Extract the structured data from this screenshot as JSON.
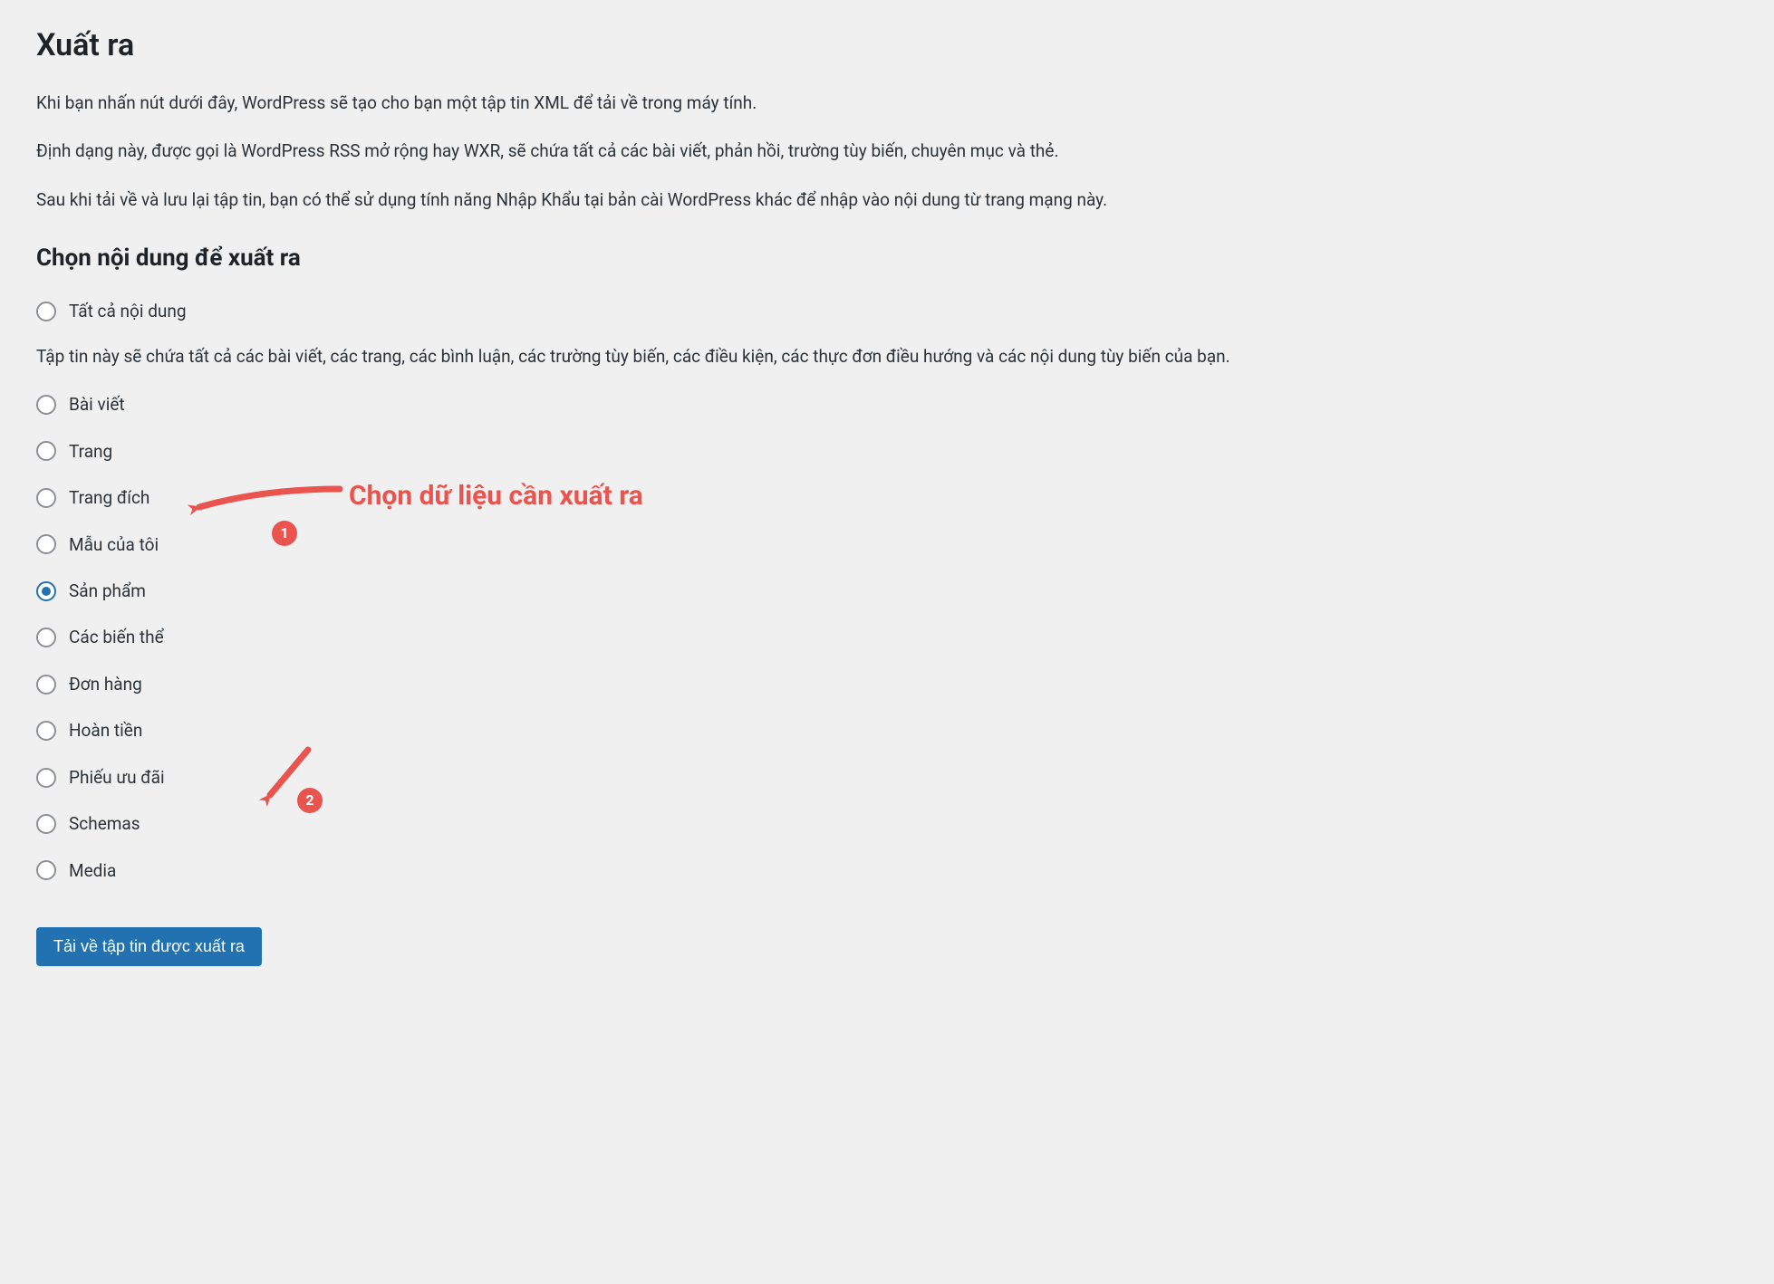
{
  "page": {
    "title": "Xuất ra",
    "intro1": "Khi bạn nhấn nút dưới đây, WordPress sẽ tạo cho bạn một tập tin XML để tải về trong máy tính.",
    "intro2": "Định dạng này, được gọi là WordPress RSS mở rộng hay WXR, sẽ chứa tất cả các bài viết, phản hồi, trường tùy biến, chuyên mục và thẻ.",
    "intro3": "Sau khi tải về và lưu lại tập tin, bạn có thể sử dụng tính năng Nhập Khẩu tại bản cài WordPress khác để nhập vào nội dung từ trang mạng này.",
    "section_title": "Chọn nội dung để xuất ra",
    "hint": "Tập tin này sẽ chứa tất cả các bài viết, các trang, các bình luận, các trường tùy biến, các điều kiện, các thực đơn điều hướng và các nội dung tùy biến của bạn.",
    "download_label": "Tải về tập tin được xuất ra"
  },
  "options": {
    "all": {
      "label": "Tất cả nội dung",
      "checked": false
    },
    "posts": {
      "label": "Bài viết",
      "checked": false
    },
    "pages": {
      "label": "Trang",
      "checked": false
    },
    "landing": {
      "label": "Trang đích",
      "checked": false
    },
    "templates": {
      "label": "Mẫu của tôi",
      "checked": false
    },
    "products": {
      "label": "Sản phẩm",
      "checked": true
    },
    "variations": {
      "label": "Các biến thể",
      "checked": false
    },
    "orders": {
      "label": "Đơn hàng",
      "checked": false
    },
    "refunds": {
      "label": "Hoàn tiền",
      "checked": false
    },
    "coupons": {
      "label": "Phiếu ưu đãi",
      "checked": false
    },
    "schemas": {
      "label": "Schemas",
      "checked": false
    },
    "media": {
      "label": "Media",
      "checked": false
    }
  },
  "annotations": {
    "text1": "Chọn dữ liệu cần xuất ra",
    "badge1": "1",
    "badge2": "2",
    "color": "#e9544f"
  }
}
